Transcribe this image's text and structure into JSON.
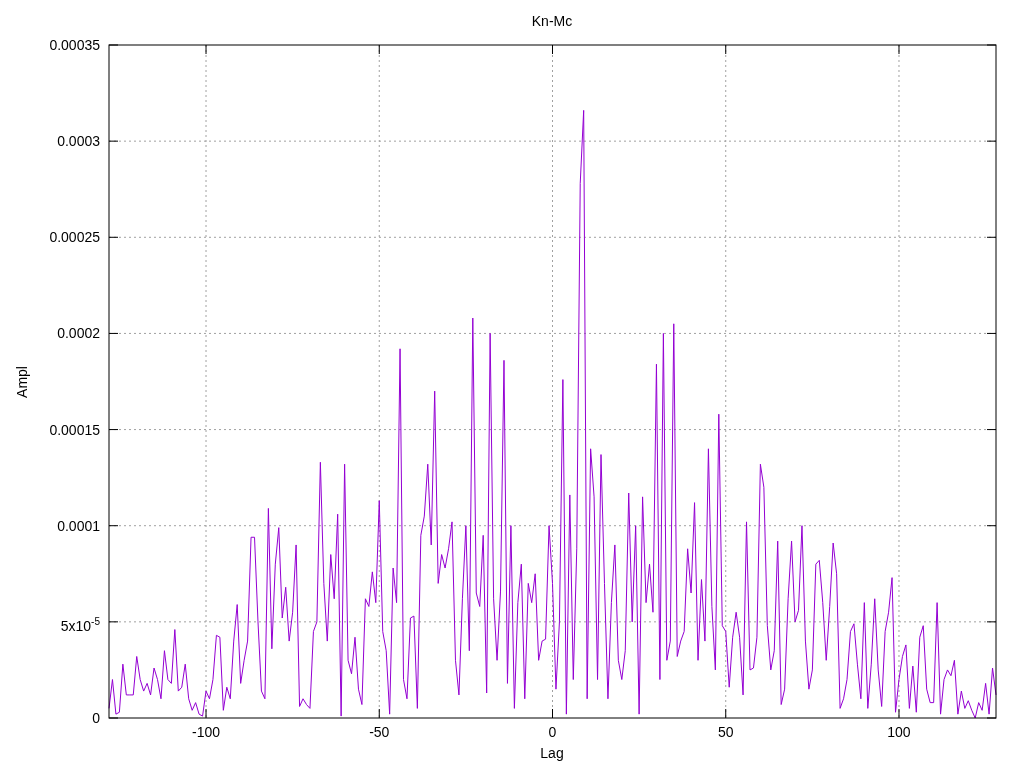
{
  "chart_data": {
    "type": "line",
    "title": "Kn-Mc",
    "xlabel": "Lag",
    "ylabel": "Ampl",
    "grid": true,
    "xlim": [
      -128,
      128
    ],
    "ylim": [
      0,
      0.00035
    ],
    "xticks": [
      {
        "value": -100,
        "label": "-100"
      },
      {
        "value": -50,
        "label": "-50"
      },
      {
        "value": 0,
        "label": "0"
      },
      {
        "value": 50,
        "label": "50"
      },
      {
        "value": 100,
        "label": "100"
      }
    ],
    "yticks": [
      {
        "value": 0,
        "label": "0"
      },
      {
        "value": 5e-05,
        "label": "5x10$^{-5}$"
      },
      {
        "value": 0.0001,
        "label": "0.0001"
      },
      {
        "value": 0.00015,
        "label": "0.00015"
      },
      {
        "value": 0.0002,
        "label": "0.0002"
      },
      {
        "value": 0.00025,
        "label": "0.00025"
      },
      {
        "value": 0.0003,
        "label": "0.0003"
      },
      {
        "value": 0.00035,
        "label": "0.00035"
      }
    ],
    "x": [
      -128,
      -127,
      -126,
      -125,
      -124,
      -123,
      -122,
      -121,
      -120,
      -119,
      -118,
      -117,
      -116,
      -115,
      -114,
      -113,
      -112,
      -111,
      -110,
      -109,
      -108,
      -107,
      -106,
      -105,
      -104,
      -103,
      -102,
      -101,
      -100,
      -99,
      -98,
      -97,
      -96,
      -95,
      -94,
      -93,
      -92,
      -91,
      -90,
      -89,
      -88,
      -87,
      -86,
      -85,
      -84,
      -83,
      -82,
      -81,
      -80,
      -79,
      -78,
      -77,
      -76,
      -75,
      -74,
      -73,
      -72,
      -71,
      -70,
      -69,
      -68,
      -67,
      -66,
      -65,
      -64,
      -63,
      -62,
      -61,
      -60,
      -59,
      -58,
      -57,
      -56,
      -55,
      -54,
      -53,
      -52,
      -51,
      -50,
      -49,
      -48,
      -47,
      -46,
      -45,
      -44,
      -43,
      -42,
      -41,
      -40,
      -39,
      -38,
      -37,
      -36,
      -35,
      -34,
      -33,
      -32,
      -31,
      -30,
      -29,
      -28,
      -27,
      -26,
      -25,
      -24,
      -23,
      -22,
      -21,
      -20,
      -19,
      -18,
      -17,
      -16,
      -15,
      -14,
      -13,
      -12,
      -11,
      -10,
      -9,
      -8,
      -7,
      -6,
      -5,
      -4,
      -3,
      -2,
      -1,
      0,
      1,
      2,
      3,
      4,
      5,
      6,
      7,
      8,
      9,
      10,
      11,
      12,
      13,
      14,
      15,
      16,
      17,
      18,
      19,
      20,
      21,
      22,
      23,
      24,
      25,
      26,
      27,
      28,
      29,
      30,
      31,
      32,
      33,
      34,
      35,
      36,
      37,
      38,
      39,
      40,
      41,
      42,
      43,
      44,
      45,
      46,
      47,
      48,
      49,
      50,
      51,
      52,
      53,
      54,
      55,
      56,
      57,
      58,
      59,
      60,
      61,
      62,
      63,
      64,
      65,
      66,
      67,
      68,
      69,
      70,
      71,
      72,
      73,
      74,
      75,
      76,
      77,
      78,
      79,
      80,
      81,
      82,
      83,
      84,
      85,
      86,
      87,
      88,
      89,
      90,
      91,
      92,
      93,
      94,
      95,
      96,
      97,
      98,
      99,
      100,
      101,
      102,
      103,
      104,
      105,
      106,
      107,
      108,
      109,
      110,
      111,
      112,
      113,
      114,
      115,
      116,
      117,
      118,
      119,
      120,
      121,
      122,
      123,
      124,
      125,
      126,
      127,
      128
    ],
    "series": [
      {
        "color": "#9400d3",
        "values": [
          5e-06,
          2e-05,
          2e-06,
          3e-06,
          2.8e-05,
          1.2e-05,
          1.2e-05,
          1.2e-05,
          3.2e-05,
          2e-05,
          1.4e-05,
          1.8e-05,
          1.2e-05,
          2.6e-05,
          2e-05,
          1e-05,
          3.5e-05,
          2e-05,
          1.8e-05,
          4.6e-05,
          1.4e-05,
          1.6e-05,
          2.8e-05,
          1e-05,
          4e-06,
          8e-06,
          2e-06,
          1e-06,
          1.4e-05,
          1e-05,
          2e-05,
          4.3e-05,
          4.2e-05,
          4e-06,
          1.6e-05,
          1e-05,
          4e-05,
          5.9e-05,
          1.8e-05,
          3e-05,
          4e-05,
          9.4e-05,
          9.4e-05,
          5e-05,
          1.4e-05,
          1e-05,
          0.000109,
          3.6e-05,
          8e-05,
          9.9e-05,
          5.2e-05,
          6.8e-05,
          4e-05,
          5.5e-05,
          9e-05,
          6e-06,
          1e-05,
          7e-06,
          5e-06,
          4.5e-05,
          5e-05,
          0.000133,
          7e-05,
          4e-05,
          8.5e-05,
          6.2e-05,
          0.000106,
          1e-06,
          0.000132,
          3e-05,
          2.3e-05,
          4.2e-05,
          1.5e-05,
          7e-06,
          6.2e-05,
          5.8e-05,
          7.6e-05,
          6e-05,
          0.000113,
          4.5e-05,
          3.5e-05,
          2e-06,
          7.8e-05,
          6e-05,
          0.000192,
          2e-05,
          1e-05,
          5.2e-05,
          5.3e-05,
          5e-06,
          9.5e-05,
          0.000105,
          0.000132,
          9e-05,
          0.00017,
          7e-05,
          8.5e-05,
          7.8e-05,
          8.8e-05,
          0.000102,
          3e-05,
          1.2e-05,
          6.2e-05,
          0.0001,
          3.5e-05,
          0.000208,
          6.5e-05,
          5.8e-05,
          9.5e-05,
          1.3e-05,
          0.0002,
          6.2e-05,
          3e-05,
          6.6e-05,
          0.000186,
          1.8e-05,
          0.0001,
          5e-06,
          6e-05,
          8e-05,
          1e-05,
          7e-05,
          6e-05,
          7.5e-05,
          3e-05,
          4e-05,
          4.1e-05,
          0.0001,
          7e-05,
          1.5e-05,
          5e-05,
          0.000176,
          2e-06,
          0.000116,
          2e-05,
          8.8e-05,
          0.000278,
          0.000316,
          1e-05,
          0.00014,
          0.000115,
          2e-05,
          0.000137,
          7e-05,
          1e-05,
          6e-05,
          9e-05,
          3e-05,
          2e-05,
          3.5e-05,
          0.000117,
          5e-05,
          0.0001,
          2e-06,
          0.000115,
          6e-05,
          8e-05,
          5.5e-05,
          0.000184,
          2e-05,
          0.0002,
          3e-05,
          4e-05,
          0.000205,
          3.2e-05,
          4e-05,
          4.5e-05,
          8.8e-05,
          6.5e-05,
          0.000112,
          3e-05,
          7.2e-05,
          4e-05,
          0.00014,
          5.8e-05,
          2.5e-05,
          0.000158,
          4.8e-05,
          4.5e-05,
          1.6e-05,
          4.2e-05,
          5.5e-05,
          4.2e-05,
          1.2e-05,
          0.000102,
          2.5e-05,
          2.6e-05,
          4.2e-05,
          0.000132,
          0.00012,
          4.8e-05,
          2.5e-05,
          3.5e-05,
          9.2e-05,
          7e-06,
          1.5e-05,
          6.2e-05,
          9.2e-05,
          5e-05,
          5.6e-05,
          0.0001,
          4e-05,
          1.5e-05,
          2.5e-05,
          8e-05,
          8.2e-05,
          6e-05,
          3e-05,
          5.8e-05,
          9.1e-05,
          7.5e-05,
          5e-06,
          1e-05,
          2e-05,
          4.5e-05,
          4.9e-05,
          2.8e-05,
          1e-05,
          6e-05,
          5e-06,
          2.8e-05,
          6.2e-05,
          2.5e-05,
          6e-06,
          4.5e-05,
          5.5e-05,
          7.3e-05,
          3e-06,
          2e-05,
          3.2e-05,
          3.8e-05,
          5e-06,
          2.7e-05,
          3e-06,
          4.2e-05,
          4.8e-05,
          1.5e-05,
          8e-06,
          8e-06,
          6e-05,
          2e-06,
          2e-05,
          2.5e-05,
          2.2e-05,
          3e-05,
          2e-06,
          1.4e-05,
          5e-06,
          9e-06,
          4e-06,
          0,
          8e-06,
          4e-06,
          1.8e-05,
          2e-06,
          2.6e-05,
          1.2e-05
        ]
      }
    ]
  }
}
